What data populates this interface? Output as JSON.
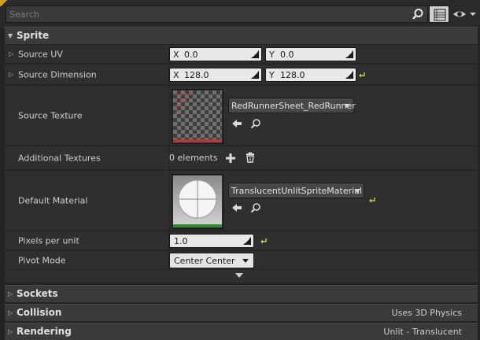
{
  "search": {
    "placeholder": "Search"
  },
  "sections": {
    "sprite": {
      "title": "Sprite"
    },
    "sockets": {
      "title": "Sockets"
    },
    "collision": {
      "title": "Collision",
      "value": "Uses 3D Physics"
    },
    "rendering": {
      "title": "Rendering",
      "value": "Unlit - Translucent"
    }
  },
  "props": {
    "source_uv": {
      "label": "Source UV",
      "x_axis": "X",
      "x": "0.0",
      "y_axis": "Y",
      "y": "0.0"
    },
    "source_dimension": {
      "label": "Source Dimension",
      "x_axis": "X",
      "x": "128.0",
      "y_axis": "Y",
      "y": "128.0"
    },
    "source_texture": {
      "label": "Source Texture",
      "asset": "RedRunnerSheet_RedRunner"
    },
    "additional_textures": {
      "label": "Additional Textures",
      "count": "0 elements"
    },
    "default_material": {
      "label": "Default Material",
      "asset": "TranslucentUnlitSpriteMaterial"
    },
    "pixels_per_unit": {
      "label": "Pixels per unit",
      "value": "1.0"
    },
    "pivot_mode": {
      "label": "Pivot Mode",
      "value": "Center Center"
    }
  },
  "colors": {
    "accent_yellow": "#c8c84a",
    "texture_bar": "#b03a3a",
    "material_bar": "#2e8b2e"
  }
}
